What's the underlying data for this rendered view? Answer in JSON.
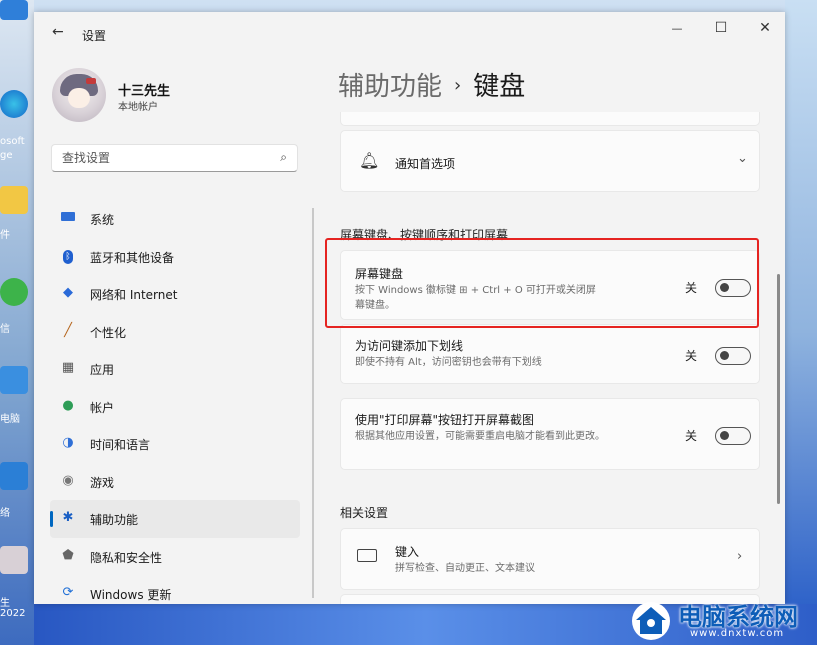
{
  "window": {
    "title": "设置",
    "back_glyph": "←",
    "controls": {
      "minimize": "—",
      "maximize": "☐",
      "close": "✕"
    }
  },
  "user": {
    "name": "十三先生",
    "account_type": "本地帐户"
  },
  "search": {
    "placeholder": "查找设置",
    "icon": "search-icon"
  },
  "nav": {
    "items": [
      {
        "label": "系统",
        "icon": "system-icon",
        "color": "#2f6fd6"
      },
      {
        "label": "蓝牙和其他设备",
        "icon": "bluetooth-icon",
        "color": "#1f5fcf"
      },
      {
        "label": "网络和 Internet",
        "icon": "network-icon",
        "color": "#2a6ad8"
      },
      {
        "label": "个性化",
        "icon": "personalization-icon",
        "color": "#b5651d"
      },
      {
        "label": "应用",
        "icon": "apps-icon",
        "color": "#555555"
      },
      {
        "label": "帐户",
        "icon": "accounts-icon",
        "color": "#2e9d57"
      },
      {
        "label": "时间和语言",
        "icon": "time-language-icon",
        "color": "#2f6fd6"
      },
      {
        "label": "游戏",
        "icon": "gaming-icon",
        "color": "#777777"
      },
      {
        "label": "辅助功能",
        "icon": "accessibility-icon",
        "color": "#1a5fc4",
        "selected": true
      },
      {
        "label": "隐私和安全性",
        "icon": "privacy-icon",
        "color": "#666666"
      },
      {
        "label": "Windows 更新",
        "icon": "windows-update-icon",
        "color": "#1f6fd6"
      }
    ]
  },
  "breadcrumb": {
    "parent": "辅助功能",
    "separator": "›",
    "current": "键盘"
  },
  "notifications_card": {
    "label": "通知首选项",
    "icon": "bell-icon"
  },
  "section_heading": "屏幕键盘、按键顺序和打印屏幕",
  "settings": [
    {
      "title": "屏幕键盘",
      "desc": "按下 Windows 徽标键 ⊞ + Ctrl + O 可打开或关闭屏幕键盘。",
      "state": "关",
      "on": false
    },
    {
      "title": "为访问键添加下划线",
      "desc": "即使不持有 Alt，访问密钥也会带有下划线",
      "state": "关",
      "on": false
    },
    {
      "title": "使用\"打印屏幕\"按钮打开屏幕截图",
      "desc": "根据其他应用设置，可能需要重启电脑才能看到此更改。",
      "state": "关",
      "on": false
    }
  ],
  "related": {
    "heading": "相关设置",
    "items": [
      {
        "title": "键入",
        "desc": "拼写检查、自动更正、文本建议",
        "icon": "keyboard-icon"
      }
    ]
  },
  "desktop": {
    "labels": [
      "osoft",
      "ge",
      "件",
      "信",
      "电脑",
      "络",
      "生",
      "2022"
    ]
  },
  "watermark": {
    "text": "电脑系统网",
    "sub": "www.dnxtw.com"
  },
  "colors": {
    "accent": "#0067c0",
    "highlight": "#e52421"
  }
}
